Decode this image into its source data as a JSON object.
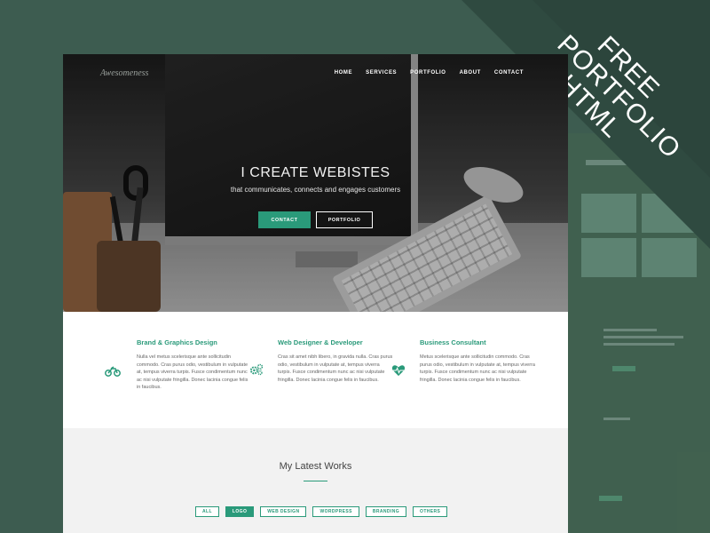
{
  "ribbon": {
    "lines": [
      "FREE",
      "PORTFOLIO",
      "HTML"
    ]
  },
  "site": {
    "logo": "Awesomeness",
    "nav": [
      "HOME",
      "SERVICES",
      "PORTFOLIO",
      "ABOUT",
      "CONTACT"
    ],
    "hero": {
      "title": "I CREATE WEBISTES",
      "subtitle": "that communicates, connects and engages customers",
      "contact_label": "CONTACT",
      "portfolio_label": "PORTFOLIO"
    },
    "services": [
      {
        "title": "Brand & Graphics Design",
        "icon": "motorbike-icon",
        "text": "Nulla vel metus scelerisque ante sollicitudin commodo. Cras purus odio, vestibulum in vulputate at, tempus viverra turpis. Fusce condimentum nunc ac nisi vulputate fringilla. Donec lacinia congue felis in faucibus."
      },
      {
        "title": "Web Designer & Developer",
        "icon": "gears-icon",
        "text": "Cras sit amet nibh libero, in gravida nulla. Cras purus odio, vestibulum in vulputate at, tempus viverra turpis. Fusce condimentum nunc ac nisi vulputate fringilla. Donec lacinia congue felis in faucibus."
      },
      {
        "title": "Business Consultant",
        "icon": "heartbeat-icon",
        "text": "Metus scelerisque ante sollicitudin commodo. Cras purus odio, vestibulum in vulputate at, tempus viverra turpis. Fusce condimentum nunc ac nisi vulputate fringilla. Donec lacinia congue felis in faucibus."
      }
    ],
    "works": {
      "title": "My Latest Works",
      "filters": [
        "ALL",
        "LOGO",
        "WEB DESIGN",
        "WORDPRESS",
        "BRANDING",
        "OTHERS"
      ],
      "active_filter": "LOGO"
    }
  },
  "colors": {
    "accent": "#2a9a7a",
    "background": "#3d5c50"
  }
}
